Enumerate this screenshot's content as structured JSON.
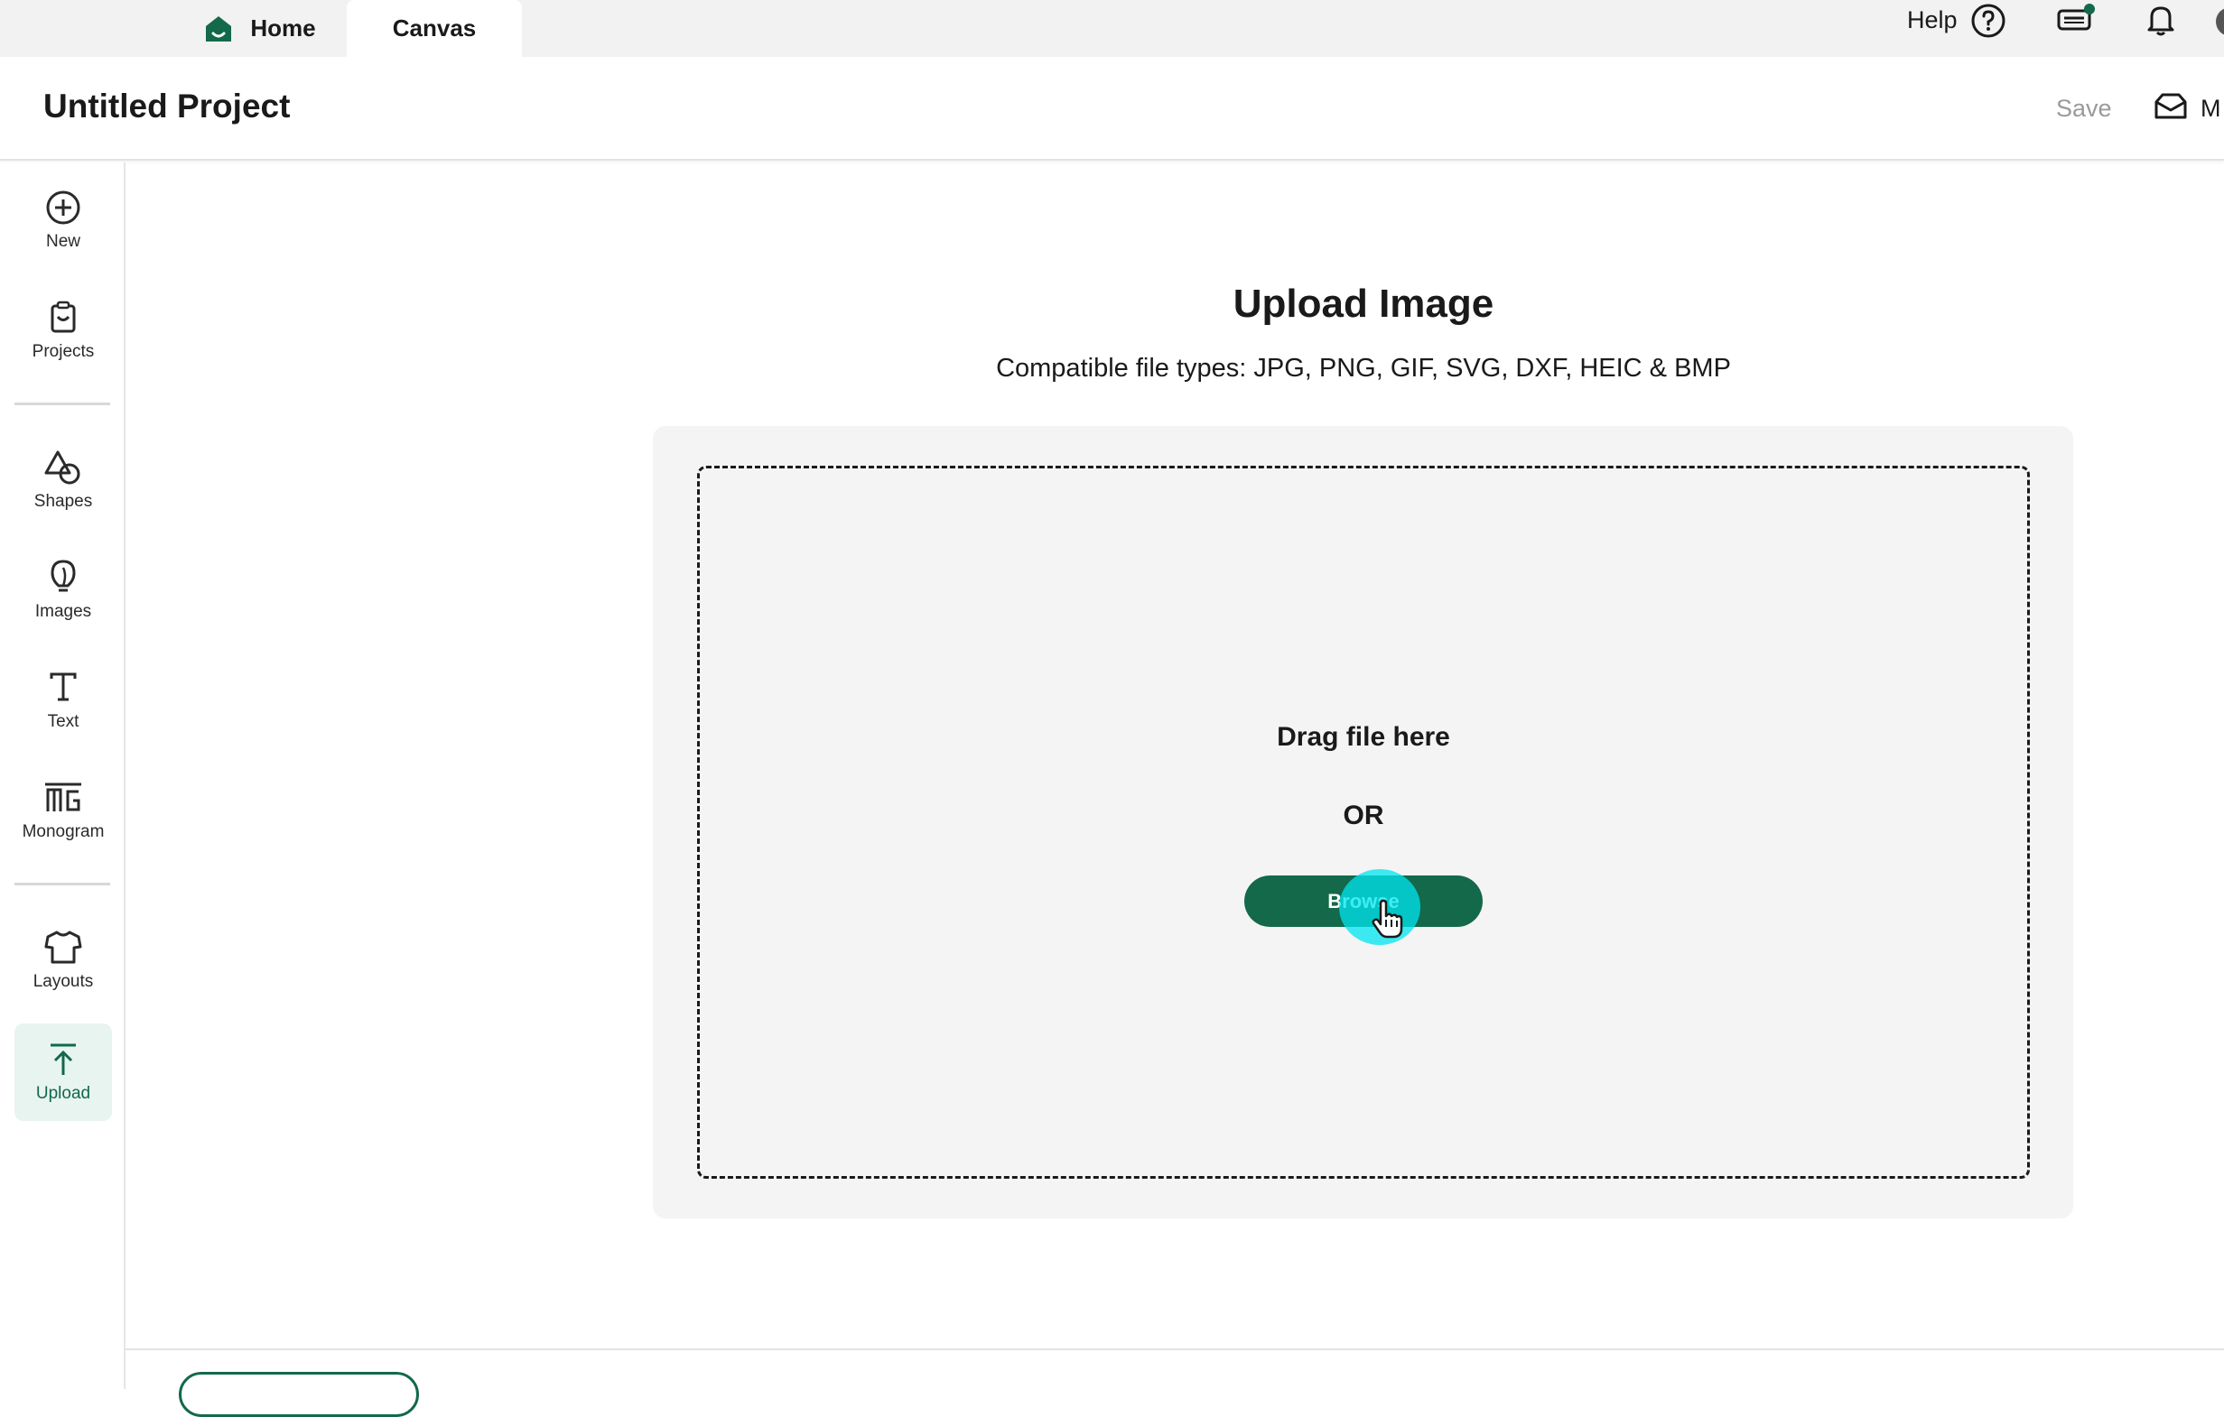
{
  "tabs": {
    "home_label": "Home",
    "canvas_label": "Canvas"
  },
  "topbar": {
    "help_label": "Help"
  },
  "header": {
    "project_title": "Untitled Project",
    "save_label": "Save",
    "mail_label": "M"
  },
  "sidebar": {
    "items": [
      {
        "label": "New",
        "icon": "plus-circle-icon"
      },
      {
        "label": "Projects",
        "icon": "projects-icon"
      },
      {
        "label": "Shapes",
        "icon": "shapes-icon"
      },
      {
        "label": "Images",
        "icon": "lightbulb-icon"
      },
      {
        "label": "Text",
        "icon": "text-icon"
      },
      {
        "label": "Monogram",
        "icon": "monogram-icon"
      },
      {
        "label": "Layouts",
        "icon": "tshirt-icon"
      },
      {
        "label": "Upload",
        "icon": "upload-icon"
      }
    ],
    "active": "Upload"
  },
  "upload": {
    "title": "Upload Image",
    "file_types": "Compatible file types:  JPG, PNG, GIF, SVG, DXF, HEIC & BMP",
    "drag_text": "Drag file here",
    "or_text": "OR",
    "browse_label": "Browse"
  },
  "colors": {
    "brand_green": "#13694a",
    "active_bg": "#e8f4ef",
    "click_highlight": "#00e6f0"
  }
}
